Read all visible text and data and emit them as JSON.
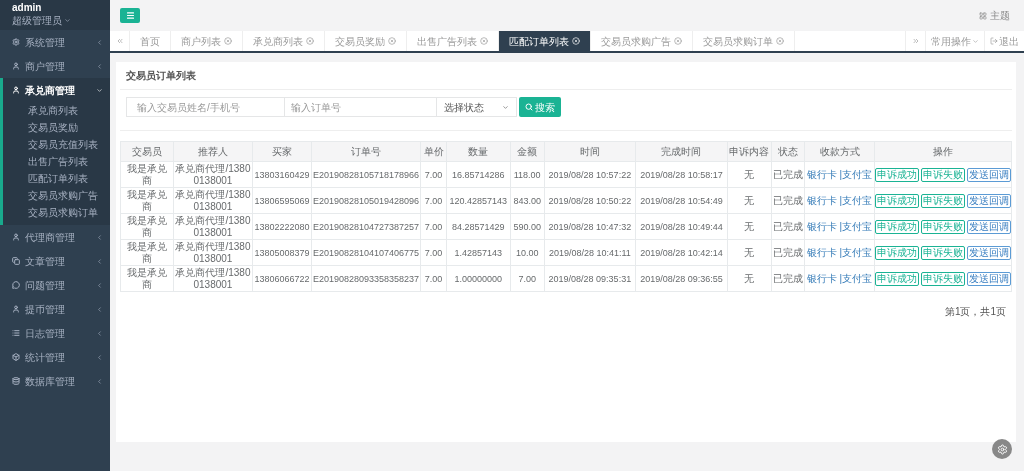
{
  "user": {
    "name": "admin",
    "role": "超级管理员"
  },
  "sidebar": {
    "items": [
      {
        "label": "系统管理",
        "expanded": false
      },
      {
        "label": "商户管理",
        "expanded": false
      },
      {
        "label": "承兑商管理",
        "expanded": true,
        "children": [
          {
            "label": "承兑商列表"
          },
          {
            "label": "交易员奖励"
          },
          {
            "label": "交易员充值列表"
          },
          {
            "label": "出售广告列表"
          },
          {
            "label": "匹配订单列表"
          },
          {
            "label": "交易员求购广告"
          },
          {
            "label": "交易员求购订单"
          }
        ]
      },
      {
        "label": "代理商管理",
        "expanded": false
      },
      {
        "label": "文章管理",
        "expanded": false
      },
      {
        "label": "问题管理",
        "expanded": false
      },
      {
        "label": "提币管理",
        "expanded": false
      },
      {
        "label": "日志管理",
        "expanded": false
      },
      {
        "label": "统计管理",
        "expanded": false
      },
      {
        "label": "数据库管理",
        "expanded": false
      }
    ]
  },
  "header": {
    "theme": "主题"
  },
  "tabs": [
    {
      "label": "首页",
      "closable": false,
      "selected": false
    },
    {
      "label": "商户列表",
      "closable": true,
      "selected": false
    },
    {
      "label": "承兑商列表",
      "closable": true,
      "selected": false
    },
    {
      "label": "交易员奖励",
      "closable": true,
      "selected": false
    },
    {
      "label": "出售广告列表",
      "closable": true,
      "selected": false
    },
    {
      "label": "匹配订单列表",
      "closable": true,
      "selected": true
    },
    {
      "label": "交易员求购广告",
      "closable": true,
      "selected": false
    },
    {
      "label": "交易员求购订单",
      "closable": true,
      "selected": false
    }
  ],
  "tab_actions": {
    "common": "常用操作",
    "logout": "退出"
  },
  "panel": {
    "title": "交易员订单列表",
    "search": {
      "name_placeholder": "输入交易员姓名/手机号",
      "order_placeholder": "输入订单号",
      "status_select": "选择状态",
      "button": "搜索"
    },
    "table": {
      "columns": [
        "交易员",
        "推荐人",
        "买家",
        "订单号",
        "单价",
        "数量",
        "金额",
        "时间",
        "完成时间",
        "申诉内容",
        "状态",
        "收款方式",
        "操作"
      ],
      "payment_separator": "|",
      "rows": [
        {
          "cells": [
            "我是承兑商",
            "承兑商代理/13800138001",
            "13803160429",
            "E20190828105718178966",
            "7.00",
            "16.85714286",
            "118.00",
            "2019/08/28 10:57:22",
            "2019/08/28 10:58:17",
            "无",
            "已完成"
          ],
          "payment": [
            "银行卡",
            "支付宝"
          ],
          "actions": [
            {
              "label": "申诉成功",
              "kind": "success"
            },
            {
              "label": "申诉失败",
              "kind": "success"
            },
            {
              "label": "发送回调",
              "kind": "info"
            }
          ]
        },
        {
          "cells": [
            "我是承兑商",
            "承兑商代理/13800138001",
            "13806595069",
            "E20190828105019428096",
            "7.00",
            "120.42857143",
            "843.00",
            "2019/08/28 10:50:22",
            "2019/08/28 10:54:49",
            "无",
            "已完成"
          ],
          "payment": [
            "银行卡",
            "支付宝"
          ],
          "actions": [
            {
              "label": "申诉成功",
              "kind": "success"
            },
            {
              "label": "申诉失败",
              "kind": "success"
            },
            {
              "label": "发送回调",
              "kind": "info"
            }
          ]
        },
        {
          "cells": [
            "我是承兑商",
            "承兑商代理/13800138001",
            "13802222080",
            "E20190828104727387257",
            "7.00",
            "84.28571429",
            "590.00",
            "2019/08/28 10:47:32",
            "2019/08/28 10:49:44",
            "无",
            "已完成"
          ],
          "payment": [
            "银行卡",
            "支付宝"
          ],
          "actions": [
            {
              "label": "申诉成功",
              "kind": "success"
            },
            {
              "label": "申诉失败",
              "kind": "success"
            },
            {
              "label": "发送回调",
              "kind": "info"
            }
          ]
        },
        {
          "cells": [
            "我是承兑商",
            "承兑商代理/13800138001",
            "13805008379",
            "E20190828104107406775",
            "7.00",
            "1.42857143",
            "10.00",
            "2019/08/28 10:41:11",
            "2019/08/28 10:42:14",
            "无",
            "已完成"
          ],
          "payment": [
            "银行卡",
            "支付宝"
          ],
          "actions": [
            {
              "label": "申诉成功",
              "kind": "success"
            },
            {
              "label": "申诉失败",
              "kind": "success"
            },
            {
              "label": "发送回调",
              "kind": "info"
            }
          ]
        },
        {
          "cells": [
            "我是承兑商",
            "承兑商代理/13800138001",
            "13806066722",
            "E20190828093358358237",
            "7.00",
            "1.00000000",
            "7.00",
            "2019/08/28 09:35:31",
            "2019/08/28 09:36:55",
            "无",
            "已完成"
          ],
          "payment": [
            "银行卡",
            "支付宝"
          ],
          "actions": [
            {
              "label": "申诉成功",
              "kind": "success"
            },
            {
              "label": "申诉失败",
              "kind": "success"
            },
            {
              "label": "发送回调",
              "kind": "info"
            }
          ]
        }
      ]
    },
    "pagination": "第1页，共1页"
  }
}
